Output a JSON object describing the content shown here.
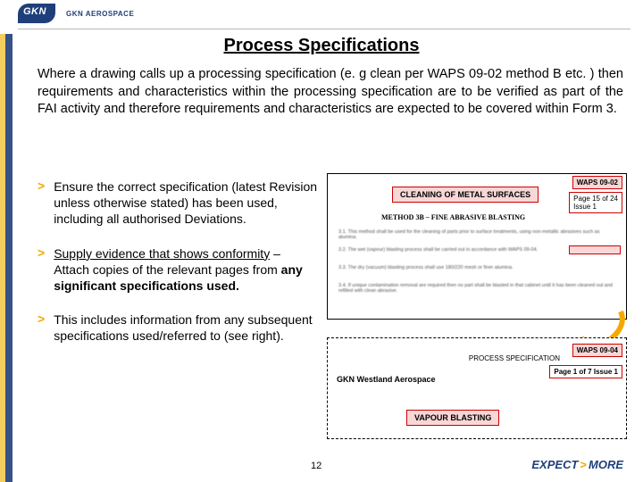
{
  "header": {
    "brand": "GKN",
    "sub": "GKN AEROSPACE"
  },
  "title": "Process Specifications",
  "intro": "Where a drawing calls up a processing specification (e. g clean per WAPS 09-02 method B etc. ) then requirements and characteristics within the processing specification are to be verified as part of the FAI activity and therefore requirements and characteristics are expected to be covered within Form 3.",
  "bullets": {
    "b1": "Ensure the correct specification (latest Revision unless otherwise stated) has been used, including all authorised Deviations.",
    "b2_lead": "Supply evidence that shows conformity",
    "b2_rest": " – Attach copies of the relevant pages from ",
    "b2_bold": "any significant specifications used.",
    "b3": "This includes information from any subsequent specifications used/referred to (see right)."
  },
  "spec1": {
    "waps": "WAPS 09-02",
    "page": "Page 15 of 24",
    "issue": "Issue          1",
    "banner": "CLEANING OF METAL SURFACES",
    "method": "METHOD 3B – FINE ABRASIVE BLASTING",
    "p31": "3.1.    This method shall be used for the cleaning of parts prior to surface treatments, using non-metallic abrasives such as alumina.",
    "p32": "3.2.    The wet (vapour) blasting process shall be carried out in accordance with WAPS 09-04.",
    "p33": "3.3.    The dry (vacuum) blasting process shall use 180/220 mesh or finer alumina.",
    "p34": "3.4.    If unique contamination removal are required then no part shall be blasted in that cabinet until it has been cleaned out and refilled with clean abrasive."
  },
  "spec2": {
    "brand": "GKN",
    "sub": "GKN Westland Aerospace",
    "ps": "PROCESS SPECIFICATION",
    "waps": "WAPS 09-04",
    "page": "Page 1 of 7",
    "issue": "Issue          1",
    "banner": "VAPOUR BLASTING"
  },
  "footer": {
    "page": "12",
    "tag_a": "EXPECT",
    "tag_b": "MORE"
  }
}
